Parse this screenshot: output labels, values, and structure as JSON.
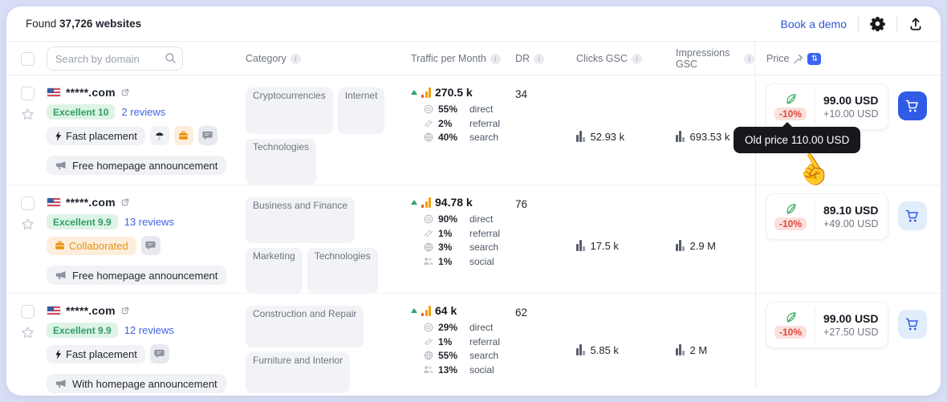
{
  "colors": {
    "accent_blue": "#3056d3",
    "cart_blue": "#2f5be7",
    "rating_green": "#2f9e62",
    "discount_red": "#e0453f",
    "tag_orange": "#e8930c",
    "traffic_bar_orange": "#f59e0b"
  },
  "topbar": {
    "found_prefix": "Found",
    "found_bold": "37,726 websites",
    "book_demo_label": "Book a demo"
  },
  "table_header": {
    "search_placeholder": "Search by domain",
    "category": "Category",
    "traffic": "Traffic per Month",
    "dr": "DR",
    "clicks": "Clicks GSC",
    "impressions": "Impressions GSC",
    "price": "Price",
    "sort_badge_glyph": "⇅"
  },
  "tooltip": {
    "text": "Old price 110.00 USD"
  },
  "rows": [
    {
      "domain": "*****.com",
      "rating_label": "Excellent 10",
      "reviews_label": "2 reviews",
      "tag": "Fast placement",
      "announcement": "Free homepage announcement",
      "categories": [
        "Cryptocurrencies",
        "Internet",
        "Technologies"
      ],
      "traffic": {
        "value": "270.5 k",
        "breakdown": [
          {
            "icon": "target-icon",
            "pct": "55%",
            "label": "direct"
          },
          {
            "icon": "link-icon",
            "pct": "2%",
            "label": "referral"
          },
          {
            "icon": "globe-icon",
            "pct": "40%",
            "label": "search"
          }
        ]
      },
      "dr": "34",
      "clicks": "52.93 k",
      "impressions": "693.53 k",
      "price": {
        "discount": "-10%",
        "amount": "99.00 USD",
        "extra": "+10.00 USD"
      }
    },
    {
      "domain": "*****.com",
      "rating_label": "Excellent 9.9",
      "reviews_label": "13 reviews",
      "tag": "Collaborated",
      "announcement": "Free homepage announcement",
      "categories": [
        "Business and Finance",
        "Marketing",
        "Technologies"
      ],
      "traffic": {
        "value": "94.78 k",
        "breakdown": [
          {
            "icon": "target-icon",
            "pct": "90%",
            "label": "direct"
          },
          {
            "icon": "link-icon",
            "pct": "1%",
            "label": "referral"
          },
          {
            "icon": "globe-icon",
            "pct": "3%",
            "label": "search"
          },
          {
            "icon": "users-icon",
            "pct": "1%",
            "label": "social"
          }
        ]
      },
      "dr": "76",
      "clicks": "17.5 k",
      "impressions": "2.9 M",
      "price": {
        "discount": "-10%",
        "amount": "89.10 USD",
        "extra": "+49.00 USD"
      }
    },
    {
      "domain": "*****.com",
      "rating_label": "Excellent 9.9",
      "reviews_label": "12 reviews",
      "tag": "Fast placement",
      "announcement": "With homepage announcement",
      "categories": [
        "Construction and Repair",
        "Furniture and Interior"
      ],
      "traffic": {
        "value": "64 k",
        "breakdown": [
          {
            "icon": "target-icon",
            "pct": "29%",
            "label": "direct"
          },
          {
            "icon": "link-icon",
            "pct": "1%",
            "label": "referral"
          },
          {
            "icon": "globe-icon",
            "pct": "55%",
            "label": "search"
          },
          {
            "icon": "users-icon",
            "pct": "13%",
            "label": "social"
          }
        ]
      },
      "dr": "62",
      "clicks": "5.85 k",
      "impressions": "2 M",
      "price": {
        "discount": "-10%",
        "amount": "99.00 USD",
        "extra": "+27.50 USD"
      }
    }
  ]
}
